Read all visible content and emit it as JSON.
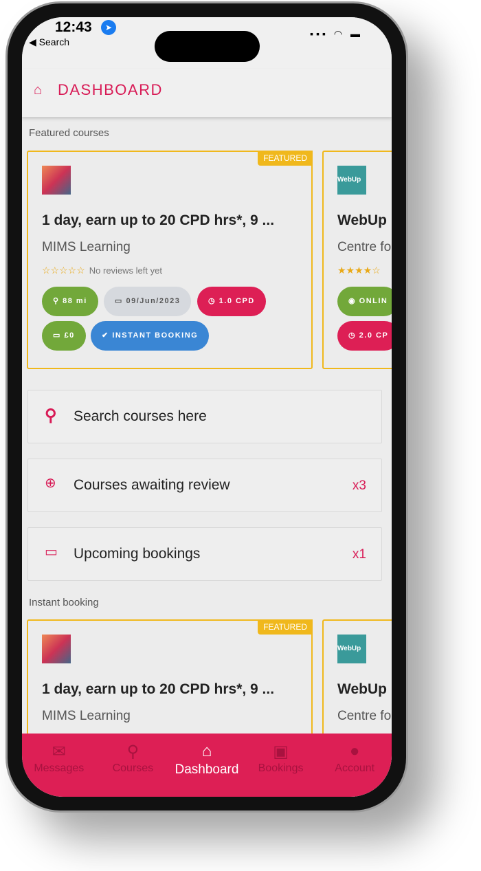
{
  "status": {
    "time": "12:43",
    "back": "◀ Search"
  },
  "header": {
    "title": "DASHBOARD",
    "icon": "home-icon"
  },
  "featured": {
    "label": "Featured courses",
    "cards": [
      {
        "badge": "FEATURED",
        "title": "1 day, earn up to 20 CPD hrs*, 9 ...",
        "provider": "MIMS Learning",
        "reviews": "No reviews left yet",
        "rating": 0,
        "distance": "88 mi",
        "date": "09/Jun/2023",
        "cpd": "1.0 CPD",
        "price": "£0",
        "instant": "INSTANT BOOKING"
      },
      {
        "title": "WebUp",
        "provider": "Centre fo",
        "rating": 4,
        "mode": "ONLIN",
        "cpd": "2.0 CP",
        "logo": "WebUp"
      }
    ]
  },
  "actions": [
    {
      "label": "Search courses here",
      "icon": "search-icon",
      "count": ""
    },
    {
      "label": "Courses awaiting review",
      "icon": "chat-plus-icon",
      "count": "x3"
    },
    {
      "label": "Upcoming bookings",
      "icon": "calendar-icon",
      "count": "x1"
    }
  ],
  "instant": {
    "label": "Instant booking",
    "cards": [
      {
        "badge": "FEATURED",
        "title": "1 day, earn up to 20 CPD hrs*, 9 ...",
        "provider": "MIMS Learning"
      },
      {
        "title": "WebUp",
        "provider": "Centre fo",
        "logo": "WebUp"
      }
    ]
  },
  "nav": [
    {
      "label": "Messages"
    },
    {
      "label": "Courses"
    },
    {
      "label": "Dashboard",
      "active": true
    },
    {
      "label": "Bookings"
    },
    {
      "label": "Account"
    }
  ],
  "colors": {
    "accent": "#dd1f55",
    "featured": "#f0b81c",
    "green": "#72a83a",
    "blue": "#3a86d4"
  }
}
